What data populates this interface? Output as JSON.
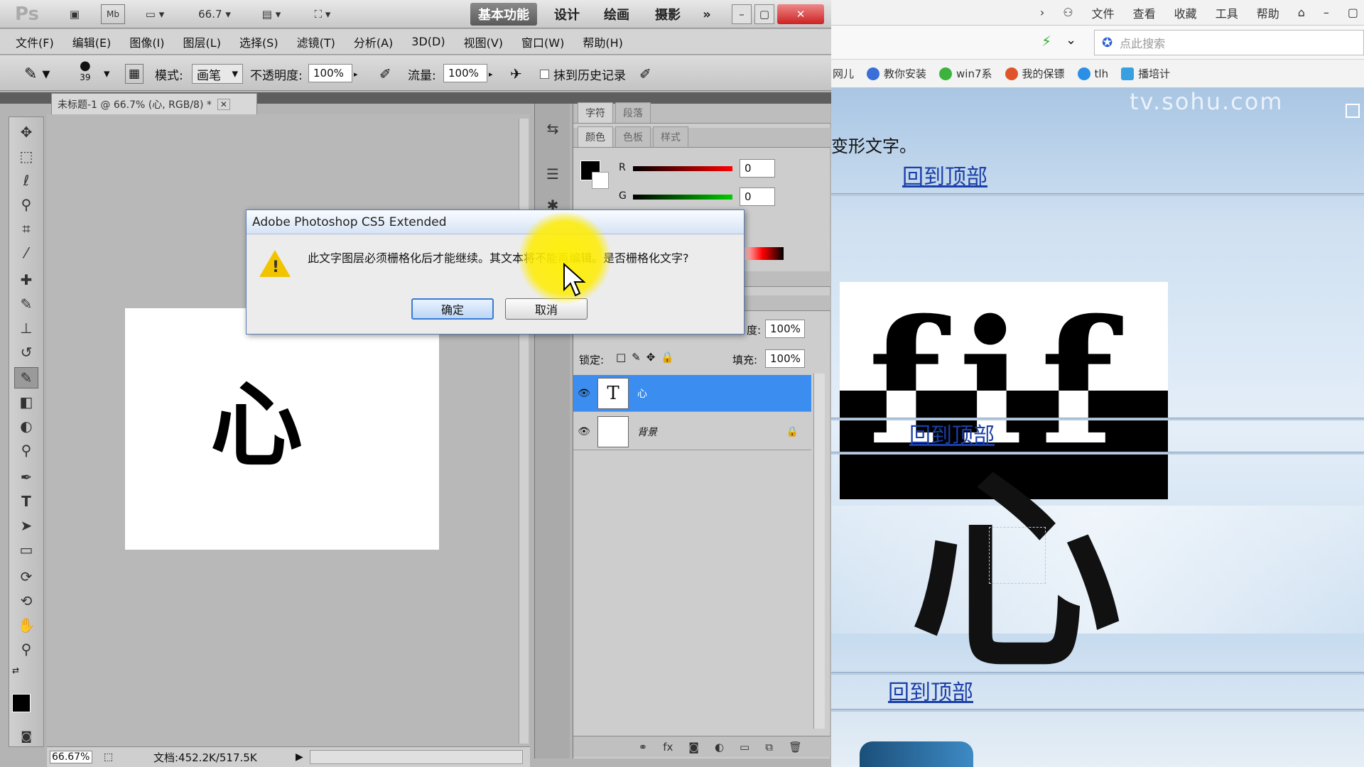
{
  "photoshop": {
    "logo": "Ps",
    "zoom_field": "66.7",
    "workspaces": [
      "基本功能",
      "设计",
      "绘画",
      "摄影",
      "»"
    ],
    "menu": [
      "文件(F)",
      "编辑(E)",
      "图像(I)",
      "图层(L)",
      "选择(S)",
      "滤镜(T)",
      "分析(A)",
      "3D(D)",
      "视图(V)",
      "窗口(W)",
      "帮助(H)"
    ],
    "options": {
      "brush_size": "39",
      "mode_label": "模式:",
      "mode_value": "画笔",
      "opacity_label": "不透明度:",
      "opacity_value": "100%",
      "flow_label": "流量:",
      "flow_value": "100%",
      "history_label": "抹到历史记录"
    },
    "document_tab": "未标题-1 @ 66.7% (心, RGB/8) *",
    "canvas_glyph": "心",
    "status": {
      "zoom": "66.67%",
      "doc_size": "文档:452.2K/517.5K"
    },
    "panels": {
      "tabs_top": [
        "字符",
        "段落"
      ],
      "tabs_color": [
        "颜色",
        "色板",
        "样式"
      ],
      "color_r_label": "R",
      "color_g_label": "G",
      "color_r_value": "0",
      "color_g_value": "0",
      "opacity_value": "100%",
      "opacity_label_fragment": "度:",
      "lock_label": "锁定:",
      "fill_label": "填充:",
      "fill_value": "100%",
      "layers": [
        {
          "thumb": "T",
          "name": "心",
          "selected": true
        },
        {
          "thumb": "",
          "name": "背景",
          "selected": false
        }
      ]
    }
  },
  "dialog": {
    "title": "Adobe Photoshop CS5 Extended",
    "message": "此文字图层必须栅格化后才能继续。其文本将不能再编辑。是否栅格化文字?",
    "ok_label": "确定",
    "cancel_label": "取消"
  },
  "browser": {
    "top_menu": [
      "文件",
      "查看",
      "收藏",
      "工具",
      "帮助"
    ],
    "search_placeholder": "点此搜索",
    "bookmarks": [
      "网儿",
      "教你安装",
      "win7系",
      "我的保镖",
      "tlh",
      "播培计"
    ],
    "watermark": "tv.sohu.com",
    "page_text": "变形文字。",
    "back_to_top": "回到顶部",
    "fif_text": "fif",
    "heart_glyph": "心"
  },
  "colors": {
    "dialog_title_bg": "#d6e3f5",
    "layer_selected": "#3b8ef0",
    "link": "#1a3fa8",
    "halo": "#ffec00"
  }
}
